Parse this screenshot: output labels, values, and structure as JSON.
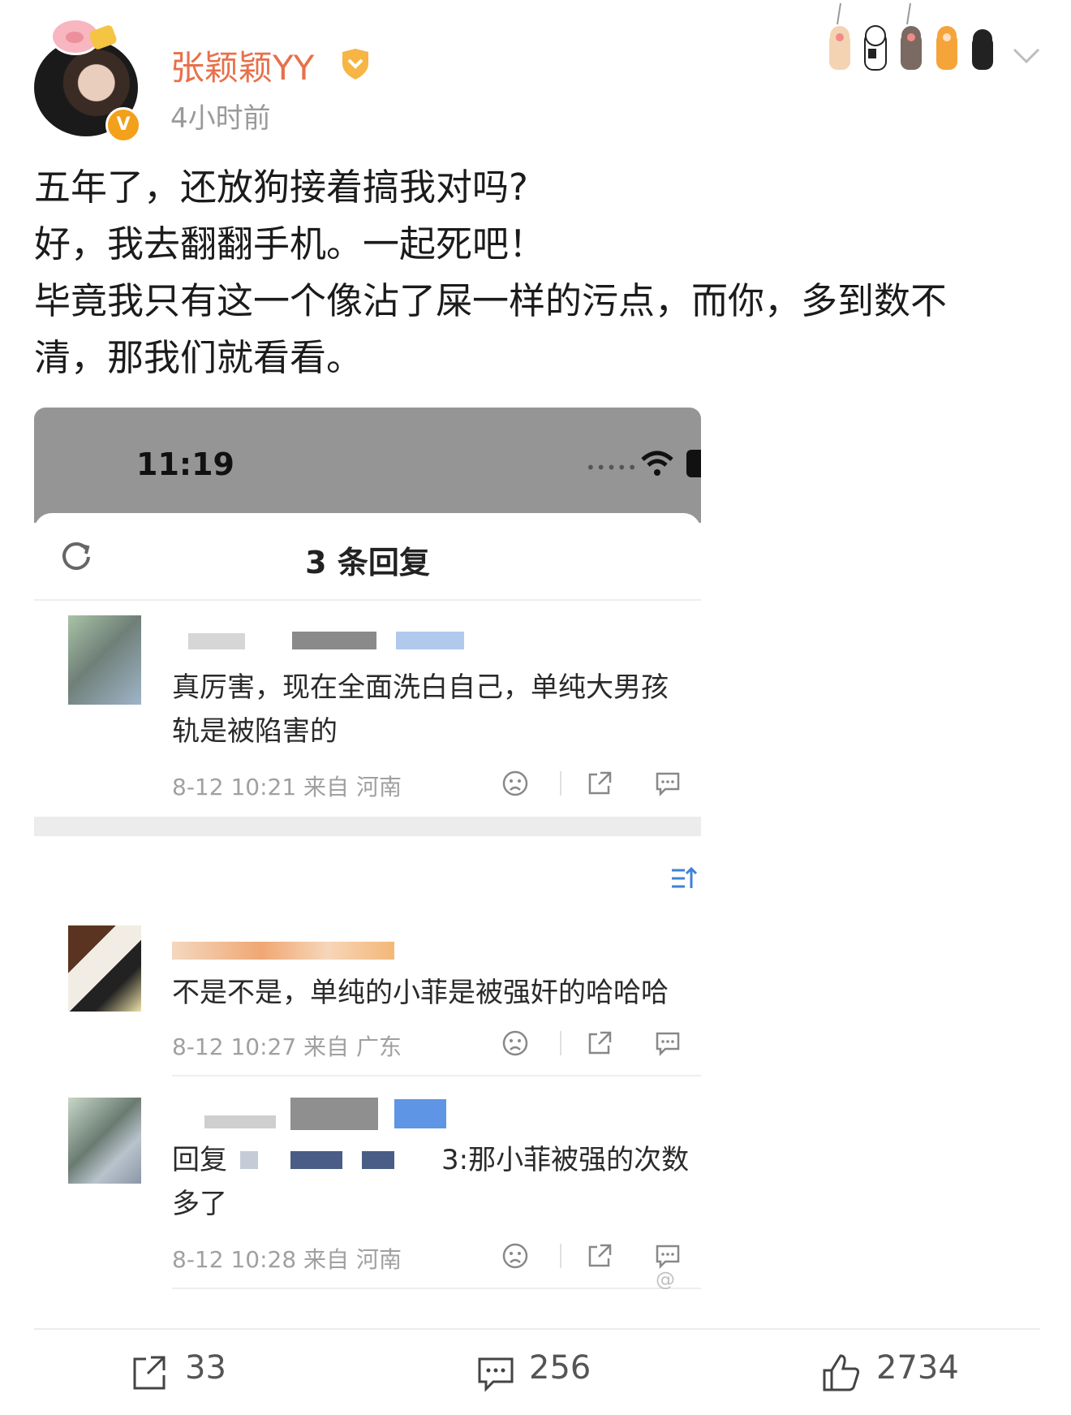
{
  "post": {
    "username": "张颖颖YY",
    "time": "4小时前",
    "verified_mark": "V",
    "text_lines": [
      "五年了，还放狗接着搞我对吗?",
      "好，我去翻翻手机。一起死吧！",
      "毕竟我只有这一个像沾了屎一样的污点，而你，多到数不",
      "清，那我们就看看。"
    ]
  },
  "screenshot": {
    "clock": "11:19",
    "signal": "•••••",
    "sheet_title": "3 条回复",
    "comments": [
      {
        "text_lines": [
          "真厉害，现在全面洗白自己，单纯大男孩",
          "轨是被陷害的"
        ],
        "meta": "8-12 10:21 来自 河南"
      },
      {
        "text_lines": [
          "不是不是，单纯的小菲是被强奸的哈哈哈"
        ],
        "meta": "8-12 10:27 来自 广东"
      },
      {
        "text_lines": [
          "回复",
          "3:那小菲被强的次数",
          "多了"
        ],
        "meta": "8-12 10:28 来自 河南"
      }
    ],
    "watermark": "@"
  },
  "footer": {
    "repost_count": "33",
    "comment_count": "256",
    "like_count": "2734"
  },
  "colors": {
    "username": "#e8704a",
    "verified": "#f3a01b",
    "status_bar": "#959595"
  },
  "icons": [
    "pig-sticker-icon",
    "verified-icon",
    "fan-badge-icon",
    "cat-paws-decoration-icon",
    "chevron-down-icon",
    "refresh-icon",
    "wifi-icon",
    "battery-icon",
    "sad-face-icon",
    "share-icon",
    "comment-icon",
    "sort-icon",
    "repost-icon",
    "like-icon"
  ]
}
